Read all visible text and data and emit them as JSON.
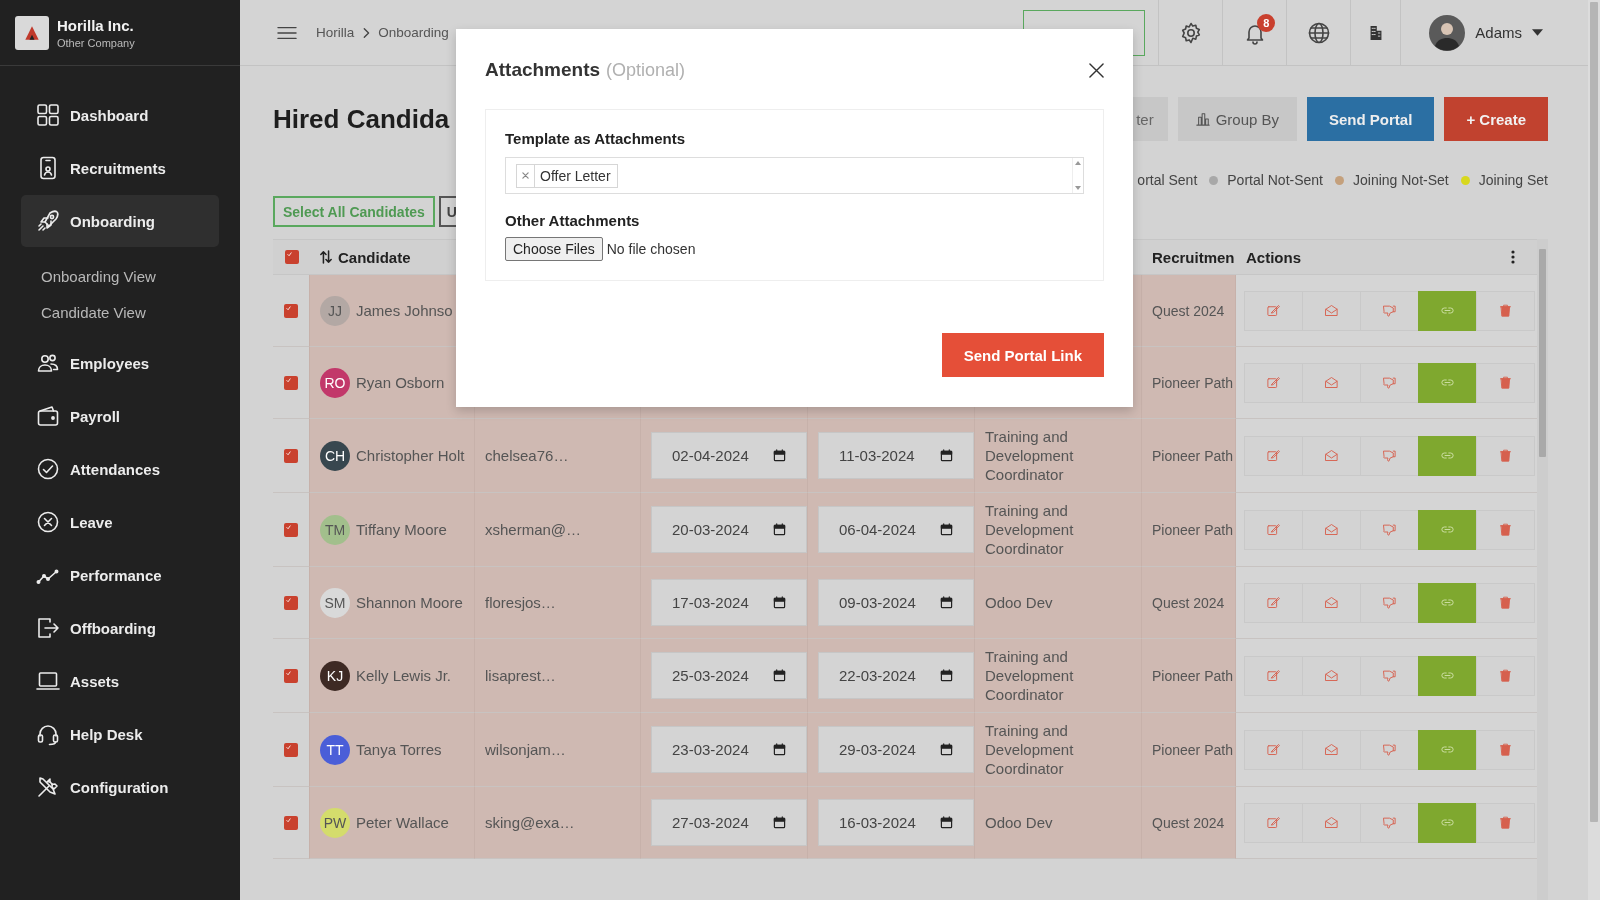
{
  "sidebar": {
    "company": "Horilla Inc.",
    "company_subtitle": "Other Company",
    "items": [
      {
        "label": "Dashboard",
        "selected": false
      },
      {
        "label": "Recruitments",
        "selected": false
      },
      {
        "label": "Onboarding",
        "selected": true,
        "children": [
          {
            "label": "Onboarding View",
            "selected": false
          },
          {
            "label": "Candidate View",
            "selected": false
          }
        ]
      },
      {
        "label": "Employees",
        "selected": false
      },
      {
        "label": "Payroll",
        "selected": false
      },
      {
        "label": "Attendances",
        "selected": false
      },
      {
        "label": "Leave",
        "selected": false
      },
      {
        "label": "Performance",
        "selected": false
      },
      {
        "label": "Offboarding",
        "selected": false
      },
      {
        "label": "Assets",
        "selected": false
      },
      {
        "label": "Help Desk",
        "selected": false
      },
      {
        "label": "Configuration",
        "selected": false
      }
    ]
  },
  "topbar": {
    "breadcrumb": [
      "Horilla",
      "Onboarding"
    ],
    "notification_count": "8",
    "user": "Adams"
  },
  "page": {
    "title": "Hired Candida",
    "buttons": [
      {
        "label": "ter",
        "kind": "plain"
      },
      {
        "label": "Group By",
        "kind": "group"
      },
      {
        "label": "Send Portal",
        "kind": "primary"
      },
      {
        "label": "+ Create",
        "kind": "danger"
      }
    ],
    "legend": [
      {
        "label": "ortal Sent"
      },
      {
        "label": "Portal Not-Sent",
        "color": "#a8a8a8"
      },
      {
        "label": "Joining Not-Set",
        "color": "#c4a07c"
      },
      {
        "label": "Joining Set",
        "color": "#d8d81e"
      }
    ],
    "bulk_buttons": [
      "Select All Candidates",
      "U"
    ]
  },
  "table": {
    "header_checked": true,
    "columns": [
      {
        "label": "Candidate",
        "kind": "candidate"
      },
      {
        "label": "Recruitmen",
        "kind": "recruitment"
      },
      {
        "label": "Actions",
        "kind": "actions"
      }
    ],
    "rows": [
      {
        "checked": true,
        "initials": "JJ",
        "color": "#b3a8a4",
        "name": "James Johnso",
        "recruitment": "Quest 2024"
      },
      {
        "checked": true,
        "initials": "RO",
        "color": "#c2386a",
        "name": "Ryan Osborn",
        "recruitment": "Pioneer Path"
      },
      {
        "checked": true,
        "initials": "CH",
        "color": "#38474f",
        "name": "Christopher Holt",
        "column_3": "chelsea76…",
        "column_4": "02-04-2024",
        "column_5": "11-03-2024",
        "column_6": "Training and Development Coordinator",
        "recruitment": "Pioneer Path"
      },
      {
        "checked": true,
        "initials": "TM",
        "color": "#a2bf8c",
        "name": "Tiffany Moore",
        "column_3": "xsherman@…",
        "column_4": "20-03-2024",
        "column_5": "06-04-2024",
        "column_6": "Training and Development Coordinator",
        "recruitment": "Pioneer Path"
      },
      {
        "checked": true,
        "initials": "SM",
        "color": "#d9d9d9",
        "name": "Shannon Moore",
        "column_3": "floresjos…",
        "column_4": "17-03-2024",
        "column_5": "09-03-2024",
        "column_6": "Odoo Dev",
        "recruitment": "Quest 2024"
      },
      {
        "checked": true,
        "initials": "KJ",
        "color": "#3e2a24",
        "name": "Kelly Lewis Jr.",
        "column_3": "lisaprest…",
        "column_4": "25-03-2024",
        "column_5": "22-03-2024",
        "column_6": "Training and Development Coordinator",
        "recruitment": "Pioneer Path"
      },
      {
        "checked": true,
        "initials": "TT",
        "color": "#4a5ed8",
        "name": "Tanya Torres",
        "column_3": "wilsonjam…",
        "column_4": "23-03-2024",
        "column_5": "29-03-2024",
        "column_6": "Training and Development Coordinator",
        "recruitment": "Pioneer Path"
      },
      {
        "checked": true,
        "initials": "PW",
        "color": "#d4dc6c",
        "name": "Peter Wallace",
        "column_3": "sking@exa…",
        "column_4": "27-03-2024",
        "column_5": "16-03-2024",
        "column_6": "Odoo Dev",
        "recruitment": "Quest 2024"
      }
    ]
  },
  "modal": {
    "title": "Attachments",
    "title_note": "(Optional)",
    "template_label": "Template as Attachments",
    "templates": [
      "Offer Letter"
    ],
    "other_label": "Other Attachments",
    "file_button": "Choose Files",
    "file_status": "No file chosen",
    "submit": "Send Portal Link"
  }
}
